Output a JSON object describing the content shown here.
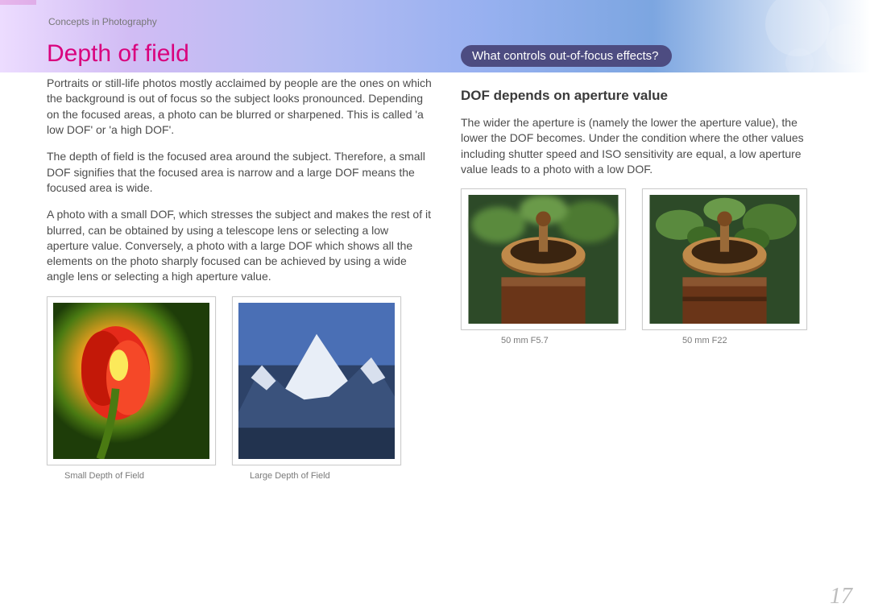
{
  "header": {
    "section": "Concepts in Photography"
  },
  "left": {
    "title": "Depth of field",
    "p1": "Portraits or still-life photos mostly acclaimed by people are the ones on which the background is out of focus so the subject looks pronounced. Depending on the focused areas, a photo can be blurred or sharpened. This is called 'a low DOF' or 'a high DOF'.",
    "p2": "The depth of field is the focused area around the subject. Therefore, a small DOF signifies that the focused area is narrow and a large DOF means the focused area is wide.",
    "p3": "A photo with a small DOF, which stresses the subject and makes the rest of it blurred, can be obtained by using a telescope lens or selecting a low aperture value. Conversely, a photo with a large DOF which shows all the elements on the photo sharply focused can be achieved by using a wide angle lens or selecting a high aperture value.",
    "images": {
      "a_caption": "Small Depth of Field",
      "b_caption": "Large Depth of Field"
    }
  },
  "right": {
    "pill": "What controls out-of-focus effects?",
    "sub": "DOF depends on aperture value",
    "p1": "The wider the aperture is (namely the lower the aperture value), the lower the DOF becomes. Under the condition where the other values including shutter speed and ISO sensitivity are equal, a low aperture value leads to a photo with a low DOF.",
    "images": {
      "a_caption": "50 mm F5.7",
      "b_caption": "50 mm F22"
    }
  },
  "page_number": "17"
}
